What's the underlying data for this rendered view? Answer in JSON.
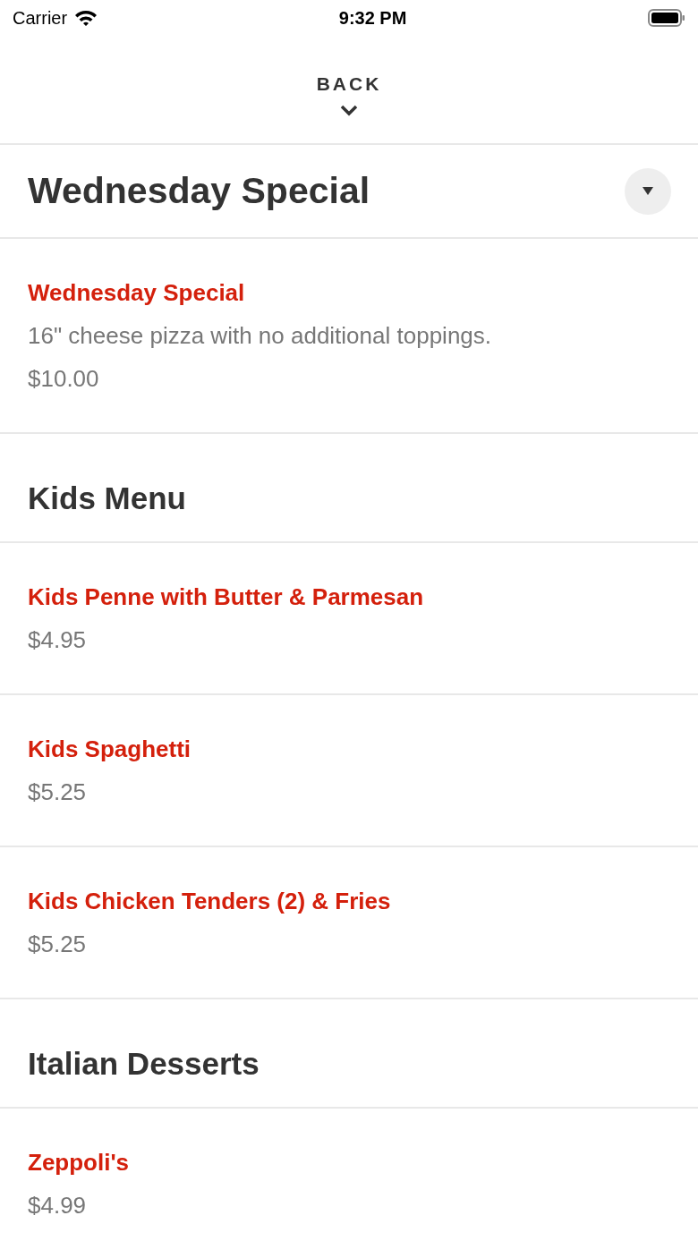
{
  "status_bar": {
    "carrier": "Carrier",
    "time": "9:32 PM"
  },
  "back": {
    "label": "BACK"
  },
  "title": "Wednesday Special",
  "sections": [
    {
      "items": [
        {
          "name": "Wednesday Special",
          "description": "16\" cheese pizza with no additional toppings.",
          "price": "$10.00"
        }
      ]
    },
    {
      "heading": "Kids Menu",
      "items": [
        {
          "name": "Kids Penne with Butter & Parmesan",
          "price": "$4.95"
        },
        {
          "name": "Kids Spaghetti",
          "price": "$5.25"
        },
        {
          "name": "Kids Chicken Tenders (2) & Fries",
          "price": "$5.25"
        }
      ]
    },
    {
      "heading": "Italian Desserts",
      "items": [
        {
          "name": "Zeppoli's",
          "price": "$4.99"
        }
      ]
    }
  ]
}
